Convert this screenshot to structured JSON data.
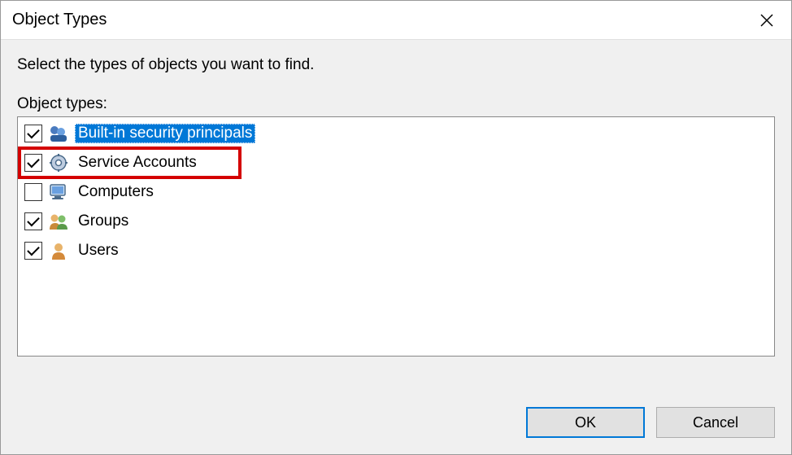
{
  "title": "Object Types",
  "instruction": "Select the types of objects you want to find.",
  "list_label": "Object types:",
  "items": [
    {
      "label": "Built-in security principals",
      "checked": true,
      "selected": true,
      "highlighted": false,
      "icon": "principals"
    },
    {
      "label": "Service Accounts",
      "checked": true,
      "selected": false,
      "highlighted": true,
      "icon": "service"
    },
    {
      "label": "Computers",
      "checked": false,
      "selected": false,
      "highlighted": false,
      "icon": "computer"
    },
    {
      "label": "Groups",
      "checked": true,
      "selected": false,
      "highlighted": false,
      "icon": "group"
    },
    {
      "label": "Users",
      "checked": true,
      "selected": false,
      "highlighted": false,
      "icon": "user"
    }
  ],
  "buttons": {
    "ok": "OK",
    "cancel": "Cancel"
  }
}
